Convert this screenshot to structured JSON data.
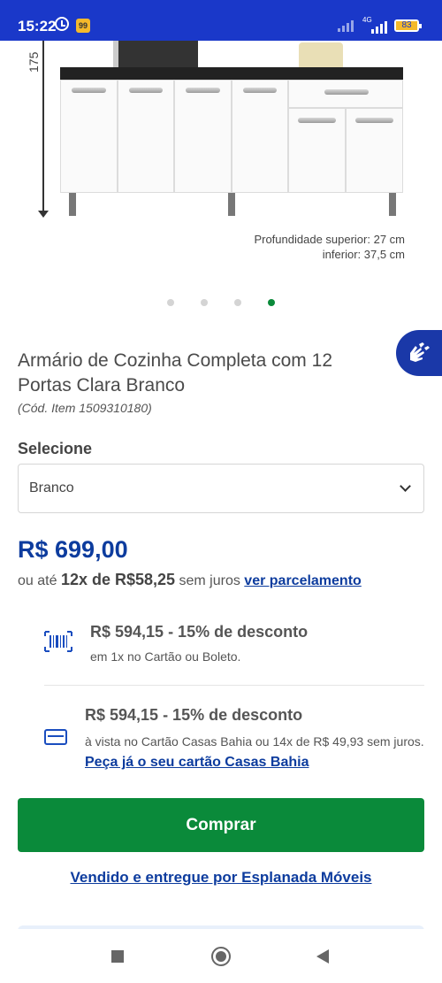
{
  "status_bar": {
    "time": "15:22",
    "network_label": "4G",
    "battery_level": "83",
    "app_badge": "99"
  },
  "product_image": {
    "height_label": "175",
    "depth_upper": "Profundidade superior: 27 cm",
    "depth_lower": "inferior: 37,5 cm",
    "carousel_total": 4,
    "carousel_active_index": 3
  },
  "product": {
    "title": "Armário de Cozinha Completa com 12 Portas Clara Branco",
    "item_code": "(Cód. Item 1509310180)"
  },
  "variant": {
    "label": "Selecione",
    "selected": "Branco"
  },
  "pricing": {
    "price": "R$ 699,00",
    "installment_prefix": "ou até",
    "installment_highlight": "12x de R$58,25",
    "installment_suffix": "sem juros",
    "installment_link": "ver parcelamento"
  },
  "offers": [
    {
      "icon": "barcode-icon",
      "title": "R$ 594,15 - 15% de desconto",
      "subtitle": "em 1x no Cartão ou Boleto."
    },
    {
      "icon": "credit-card-icon",
      "title": "R$ 594,15 - 15% de desconto",
      "subtitle": "à vista no Cartão Casas Bahia ou 14x de R$ 49,93 sem juros.",
      "link": "Peça já o seu cartão Casas Bahia"
    }
  ],
  "actions": {
    "buy_label": "Comprar",
    "seller_link": "Vendido e entregue por Esplanada Móveis"
  },
  "colors": {
    "brand_blue": "#0d3c9e",
    "status_bar": "#1a38c9",
    "buy_green": "#0a8a3a"
  }
}
